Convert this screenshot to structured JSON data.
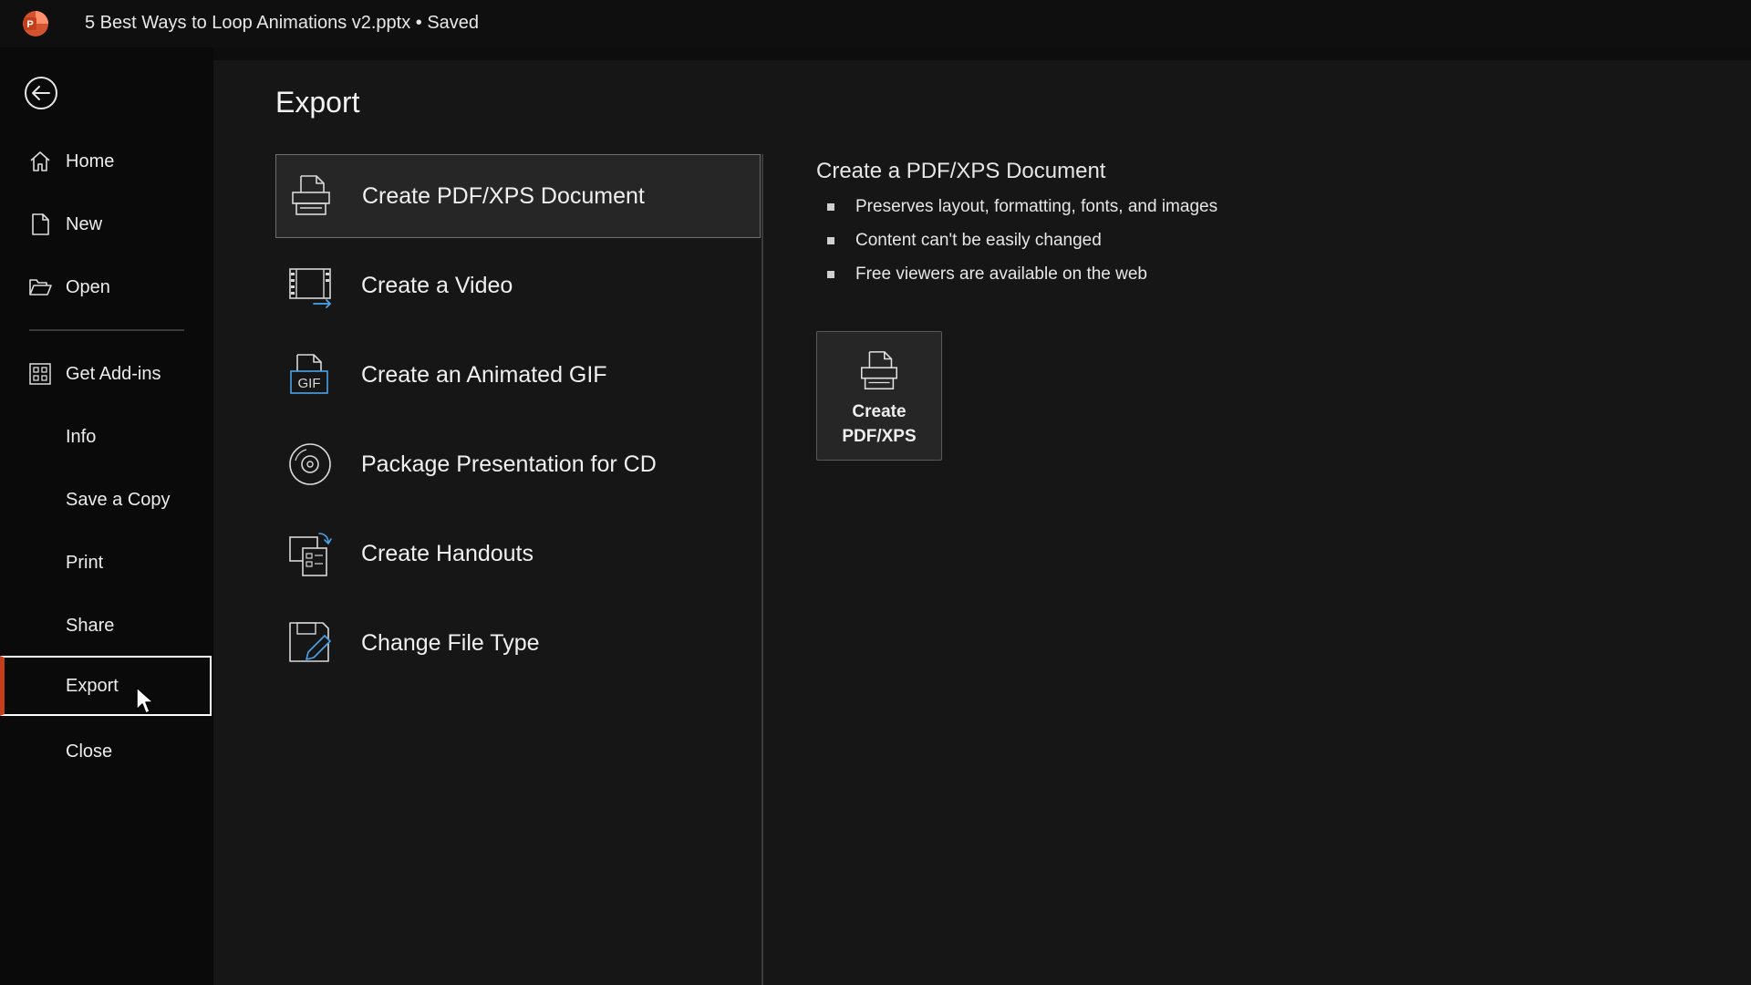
{
  "window": {
    "title": "5 Best Ways to Loop Animations v2.pptx • Saved",
    "app_icon": "powerpoint-logo-icon",
    "app_icon_letter": "P"
  },
  "sidebar": {
    "back_icon": "back-arrow-icon",
    "items": [
      {
        "id": "home",
        "label": "Home",
        "icon": "home-icon"
      },
      {
        "id": "new",
        "label": "New",
        "icon": "new-document-icon"
      },
      {
        "id": "open",
        "label": "Open",
        "icon": "folder-open-icon"
      },
      {
        "id": "get-add-ins",
        "label": "Get Add-ins",
        "icon": "grid-icon"
      },
      {
        "id": "info",
        "label": "Info"
      },
      {
        "id": "save-a-copy",
        "label": "Save a Copy"
      },
      {
        "id": "print",
        "label": "Print"
      },
      {
        "id": "share",
        "label": "Share"
      },
      {
        "id": "export",
        "label": "Export",
        "active": true
      },
      {
        "id": "close",
        "label": "Close"
      }
    ]
  },
  "main": {
    "title": "Export",
    "options": [
      {
        "label": "Create PDF/XPS Document",
        "icon": "pdf-document-icon",
        "selected": true
      },
      {
        "label": "Create a Video",
        "icon": "video-icon"
      },
      {
        "label": "Create an Animated GIF",
        "icon": "gif-icon",
        "icon_text": "GIF"
      },
      {
        "label": "Package Presentation for CD",
        "icon": "cd-icon"
      },
      {
        "label": "Create Handouts",
        "icon": "handouts-icon"
      },
      {
        "label": "Change File Type",
        "icon": "change-file-type-icon"
      }
    ],
    "detail": {
      "title": "Create a PDF/XPS Document",
      "bullets": [
        "Preserves layout, formatting, fonts, and images",
        "Content can't be easily changed",
        "Free viewers are available on the web"
      ],
      "button": {
        "line1": "Create",
        "line2": "PDF/XPS",
        "icon": "pdf-document-icon"
      }
    }
  },
  "colors": {
    "accent": "#c43e1c",
    "background": "#161616",
    "sidebar": "#0a0a0a"
  }
}
